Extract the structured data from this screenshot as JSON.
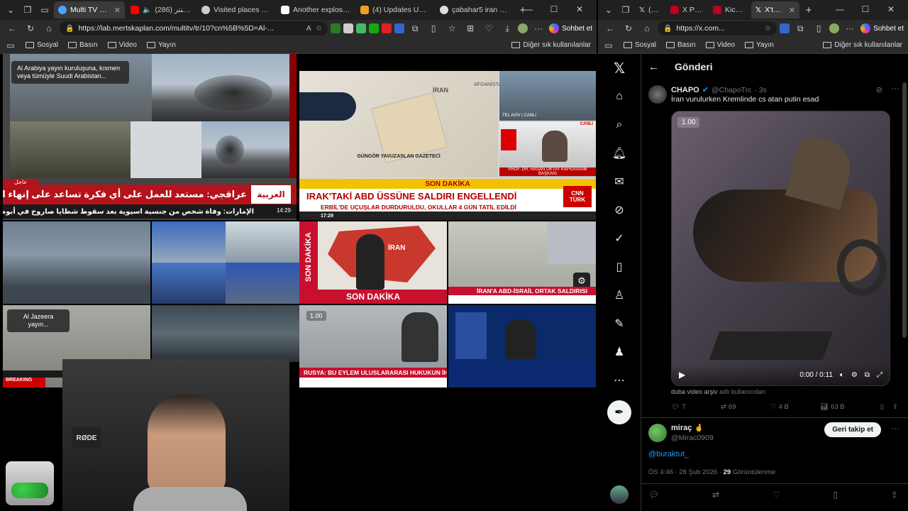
{
  "left_window": {
    "tabs": [
      {
        "label": "Multi TV - 10 li",
        "active": true,
        "color": "#4aa3ff"
      },
      {
        "label": "(286) ایران اینتر",
        "active": false,
        "color": "#ff0000"
      },
      {
        "label": "Visited places map",
        "active": false,
        "color": "#dddddd"
      },
      {
        "label": "Another explosion",
        "active": false,
        "color": "#111111"
      },
      {
        "label": "(4) Updates US, Isra",
        "active": false,
        "color": "#f0a020"
      },
      {
        "label": "çabahar5 iran - Goo",
        "active": false,
        "color": "#dddddd"
      }
    ],
    "address": "https://lab.mertskaplan.com/multitv/tr/10?cn%5B%5D=Al-...",
    "sohbet_label": "Sohbet et",
    "favorites": [
      {
        "label": "Sosyal"
      },
      {
        "label": "Basın"
      },
      {
        "label": "Video"
      },
      {
        "label": "Yayın"
      }
    ],
    "other_favorites": "Diğer sık kullanılanlar",
    "tiles": {
      "alarabiya_overlay": "Al Arabiya yayın kuruluşuna, kısmen veya tümüyle Suudi Arabistan...",
      "alarabiya_ticker1": "عراقجي: مستعد للعمل على أي فكرة تساعد على إنهاء الحرب بالشكل المناسب",
      "alarabiya_ticker2": "الإمارات: وفاة شخص من جنسية اسيوية بعد سقوط شظايا صاروخ في أبوظبي",
      "alarabiya_urgent": "عاجل",
      "alarabiya_logo": "العربية",
      "alarabiya_time": "14:29",
      "cnn_breaking": "SON DAKİKA",
      "cnn_headline": "IRAK'TAKİ ABD ÜSSÜNE SALDIRI ENGELLENDİ",
      "cnn_sub": "ERBİL'DE UÇUŞLAR DURDURULDU, OKULLAR 4 GÜN TATİL EDİLDİ",
      "cnn_logo": "CNN TÜRK",
      "cnn_time": "17:29",
      "map_label_iran": "İRAN",
      "map_label_afg": "AFGANİSTAN",
      "guest1": "GÜNGÖR YAVUZASLAN GAZETECİ",
      "guest2": "PROF. DR. HASAN OKTAY KAFKASSAM BAŞKANI",
      "guest_live": "CANLI",
      "telaviv": "TEL AVİV | CANLI",
      "son_dakika_vertical": "SON DAKİKA",
      "iran_map": "İRAN",
      "son_dakika_banner": "SON DAKİKA",
      "iran_abd_headline": "İRAN'A ABD-İSRAİL ORTAK SALDIRISI",
      "rusya_headline": "RUSYA: BU EYLEM ULUSLARARASI HUKUKUN İHLALİ",
      "speed_label": "1.00",
      "aljazeera_overlay": "Al Jazeera yayın...",
      "trt_breaking": "BREAKING"
    }
  },
  "right_window": {
    "tabs": [
      {
        "label": "(1) X P",
        "active": false
      },
      {
        "label": "X Post",
        "active": false
      },
      {
        "label": "KickPr",
        "active": false
      },
      {
        "label": "X'te m",
        "active": true
      }
    ],
    "address": "https://x.com...",
    "sohbet_label": "Sohbet et",
    "favorites": [
      {
        "label": "Sosyal"
      },
      {
        "label": "Basın"
      },
      {
        "label": "Video"
      },
      {
        "label": "Yayın"
      }
    ],
    "other_favorites": "Diğer sık kullanılanlar",
    "x": {
      "header_title": "Gönderi",
      "post": {
        "name": "CHAPO",
        "handle": "@ChapoTrc",
        "time": "· 3s",
        "text": "İran vurulurken Kremlinde cs atan putin  esad",
        "speed": "1.00",
        "video_time": "0:00 / 0:11",
        "attribution_user": "duba video arşiv",
        "attribution_suffix": "adlı kullanıcıdan",
        "replies": "7",
        "reposts": "69",
        "likes": "4 B",
        "views": "63 B"
      },
      "reply": {
        "name": "miraç",
        "emoji": "🤞",
        "handle": "@Mirac0909",
        "follow_label": "Geri takip et",
        "text": "@buraktut_",
        "timestamp": "ÖS 4:46 · 28 Şub 2026 ·",
        "views_count": "29",
        "views_label": "Görüntülenme"
      }
    }
  },
  "webcam": {
    "mic_brand": "RØDE"
  }
}
